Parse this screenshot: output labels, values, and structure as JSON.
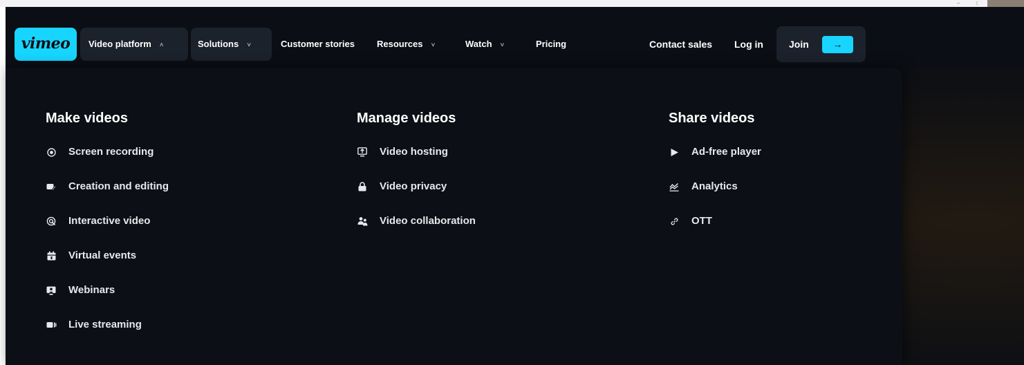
{
  "nav": {
    "logo": "vimeo",
    "items": [
      {
        "label": "Video platform",
        "chevron": "˄"
      },
      {
        "label": "Solutions",
        "chevron": "˅"
      },
      {
        "label": "Customer stories"
      },
      {
        "label": "Resources",
        "chevron": "˅"
      },
      {
        "label": "Watch",
        "chevron": "˅"
      },
      {
        "label": "Pricing"
      }
    ],
    "contact_sales": "Contact sales",
    "log_in": "Log in",
    "join": "Join",
    "join_arrow": "→"
  },
  "menu": {
    "make": {
      "title": "Make videos",
      "items": [
        {
          "label": "Screen recording",
          "icon": "record-icon"
        },
        {
          "label": "Creation and editing",
          "icon": "edit-video-icon"
        },
        {
          "label": "Interactive video",
          "icon": "interactive-icon"
        },
        {
          "label": "Virtual events",
          "icon": "calendar-icon"
        },
        {
          "label": "Webinars",
          "icon": "webinar-icon"
        },
        {
          "label": "Live streaming",
          "icon": "live-camera-icon"
        }
      ]
    },
    "manage": {
      "title": "Manage videos",
      "items": [
        {
          "label": "Video hosting",
          "icon": "upload-monitor-icon"
        },
        {
          "label": "Video privacy",
          "icon": "lock-icon"
        },
        {
          "label": "Video collaboration",
          "icon": "people-icon"
        }
      ]
    },
    "share": {
      "title": "Share videos",
      "items": [
        {
          "label": "Ad-free player",
          "icon": "play-icon"
        },
        {
          "label": "Analytics",
          "icon": "analytics-icon"
        },
        {
          "label": "OTT",
          "icon": "link-icon"
        }
      ]
    }
  },
  "colors": {
    "brand": "#17d5ff",
    "background": "#0b0e14",
    "pill": "#1c222c"
  }
}
